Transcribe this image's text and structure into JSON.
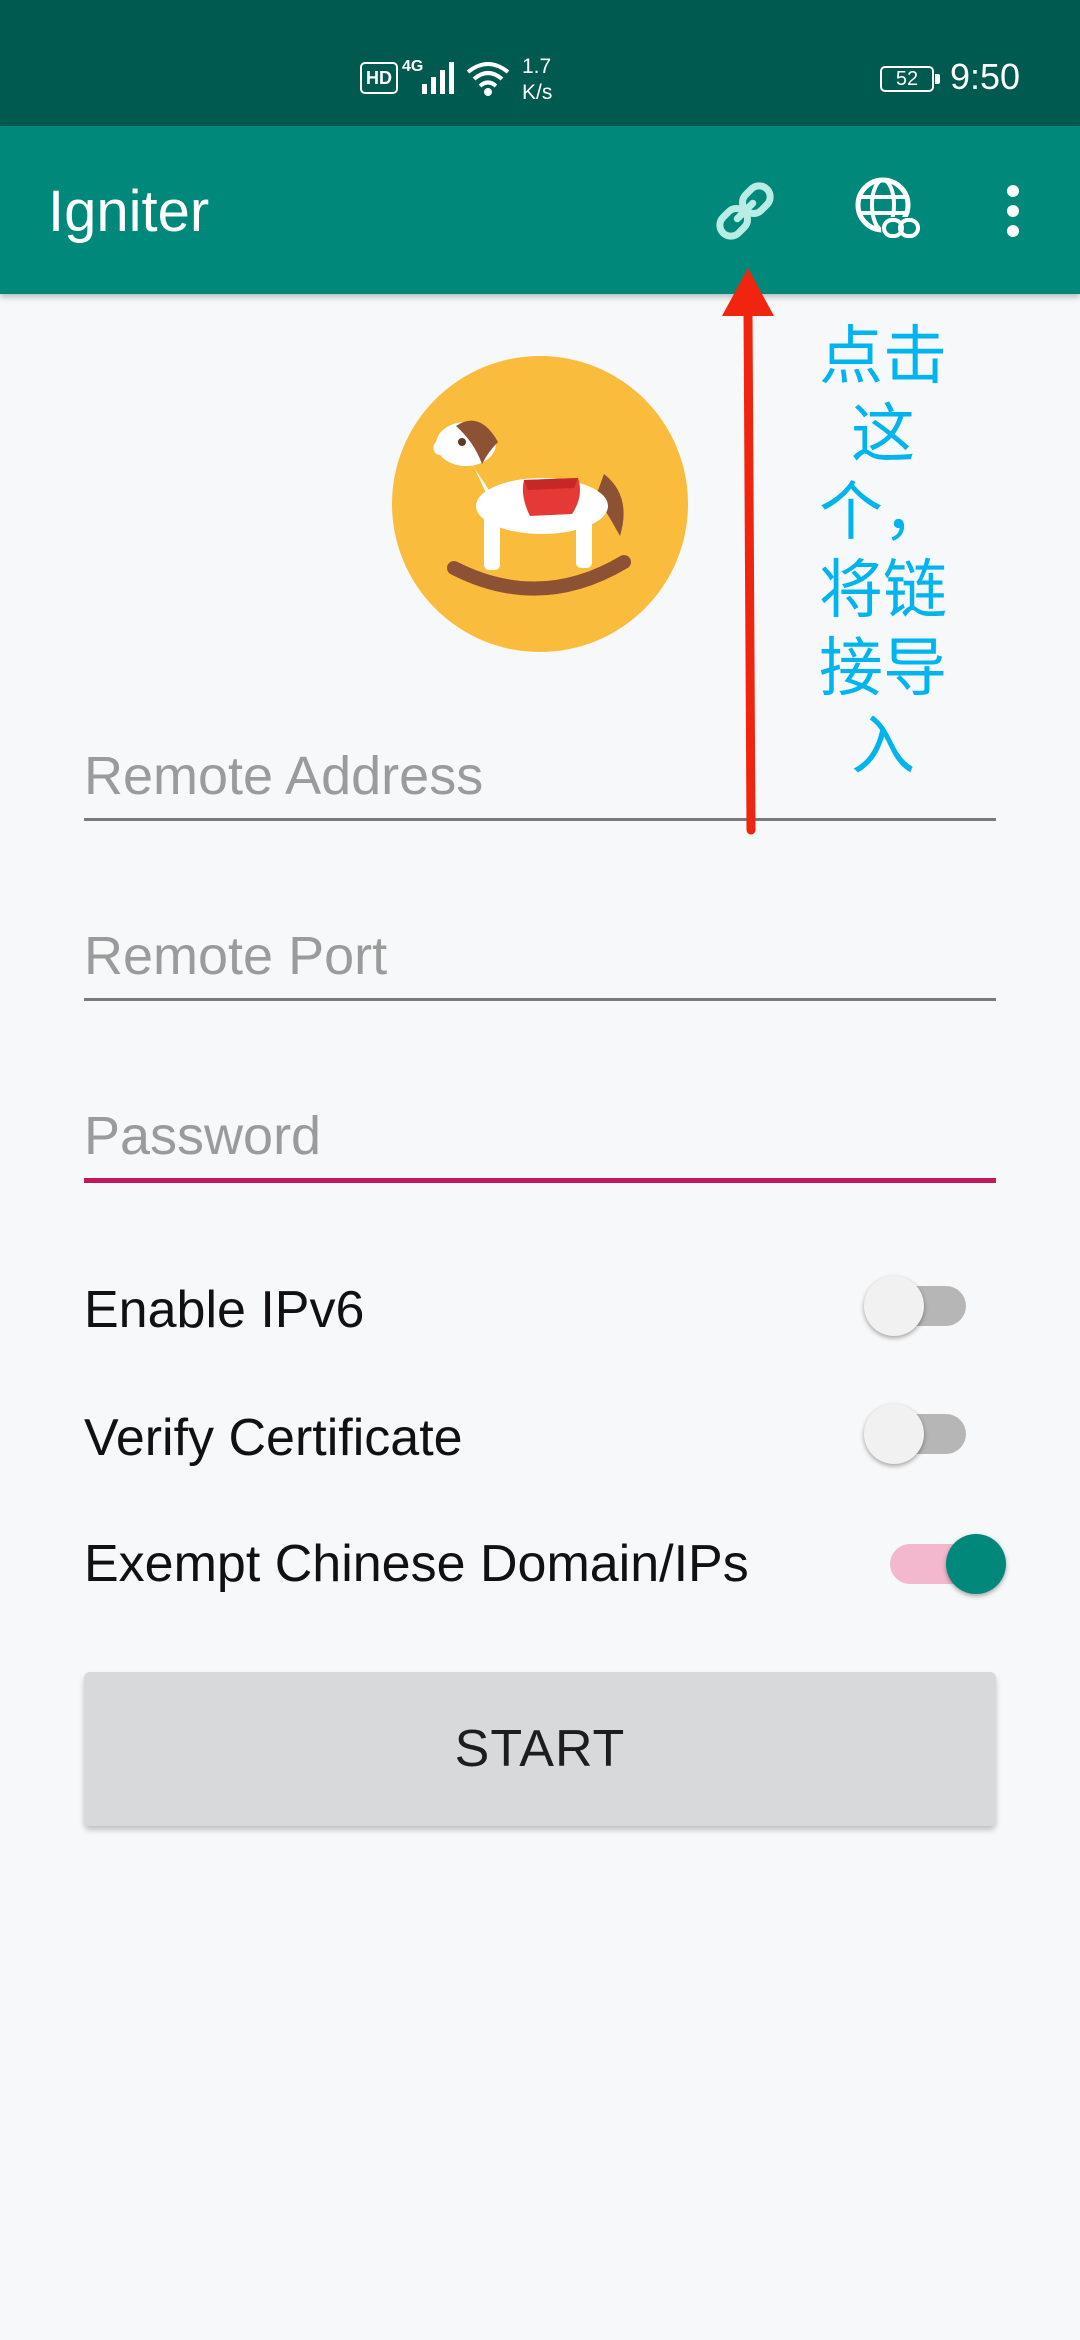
{
  "status_bar": {
    "hd": "HD",
    "network": "4G",
    "speed_value": "1.7",
    "speed_unit": "K/s",
    "battery": "52",
    "time": "9:50"
  },
  "app_bar": {
    "title": "Igniter",
    "actions": [
      {
        "icon": "link-icon"
      },
      {
        "icon": "globe-link-icon"
      },
      {
        "icon": "more-vert-icon"
      }
    ]
  },
  "annotation": {
    "text": "点击这个，将链接导入",
    "color": "#00b4ee",
    "arrow_color": "#f0250f"
  },
  "form": {
    "remote_address": {
      "placeholder": "Remote Address",
      "value": ""
    },
    "remote_port": {
      "placeholder": "Remote Port",
      "value": ""
    },
    "password": {
      "placeholder": "Password",
      "value": ""
    }
  },
  "switches": [
    {
      "label": "Enable IPv6",
      "on": false
    },
    {
      "label": "Verify Certificate",
      "on": false
    },
    {
      "label": "Exempt Chinese Domain/IPs",
      "on": true
    }
  ],
  "start_button": {
    "label": "START"
  },
  "colors": {
    "status_bar": "#005a4f",
    "app_bar": "#00897b",
    "accent": "#c2185b",
    "switch_on_thumb": "#00897b",
    "switch_on_track": "#f3b8cd"
  }
}
